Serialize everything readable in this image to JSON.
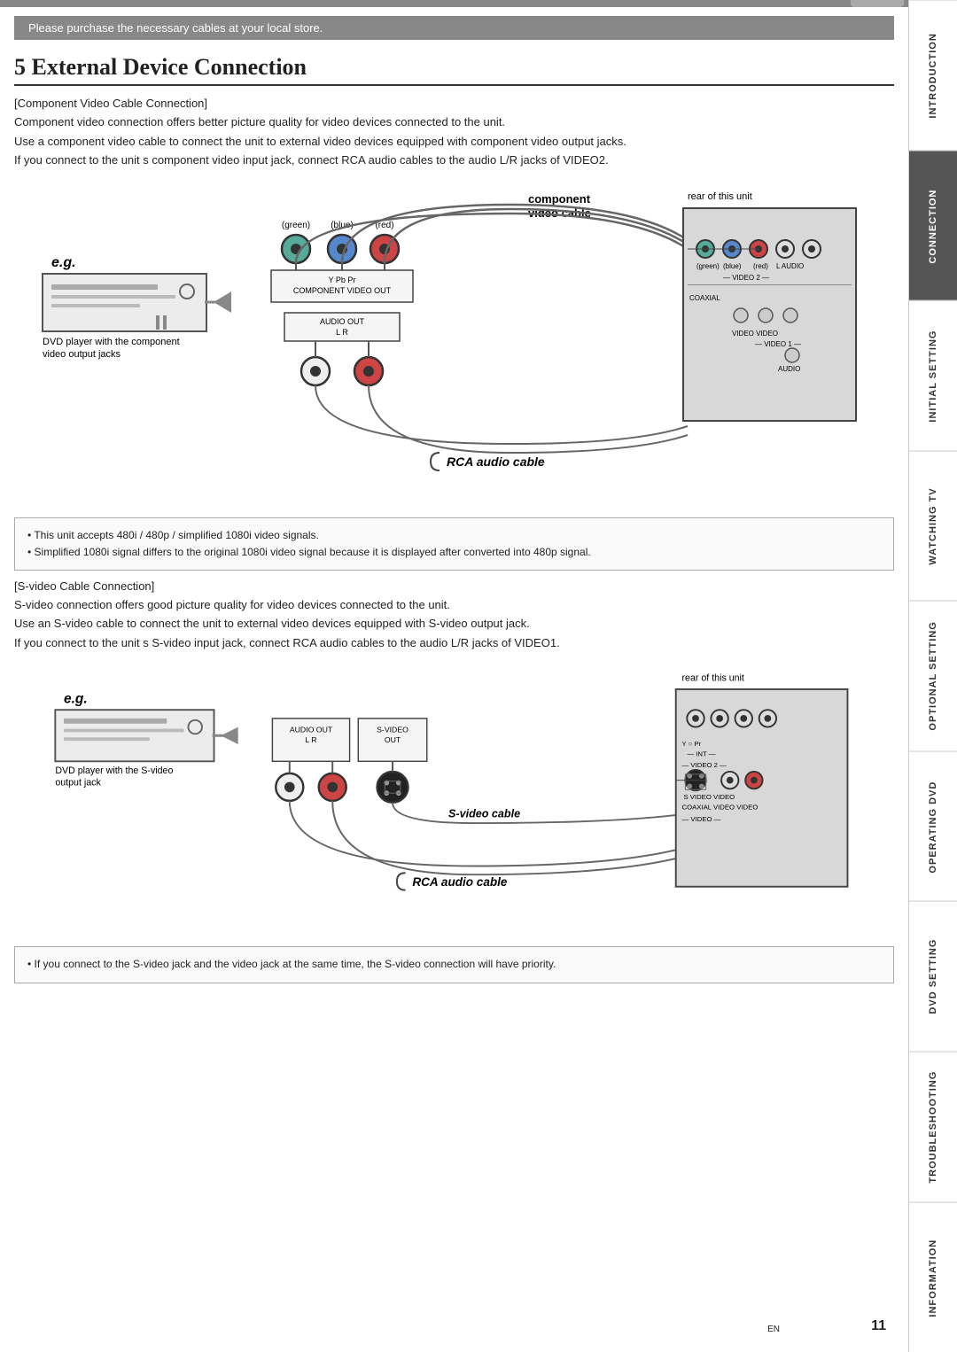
{
  "page": {
    "number": "11",
    "lang": "EN"
  },
  "notice": {
    "text": "Please purchase the necessary cables at your local store."
  },
  "chapter": {
    "number": "5",
    "title": "External Device Connection"
  },
  "component_section": {
    "heading": "[Component Video Cable Connection]",
    "para1": "Component video connection offers better picture quality for video devices connected to the unit.",
    "para2": "Use a component video cable to connect the unit to external video devices equipped with component video output jacks.",
    "para3": "If you connect to the unit s component video input jack, connect RCA audio cables to the audio L/R jacks of VIDEO2.",
    "diagram": {
      "component_cable_label": "component\nvideo cable",
      "eg_label": "e.g.",
      "dvd_label": "DVD player with the component\nvideo output jacks",
      "rear_label": "rear of this unit",
      "connector_labels": [
        "(green)",
        "(blue)",
        "(red)"
      ],
      "component_out_text": "Y    Pb    Pr\nCOMPONENT VIDEO OUT",
      "audio_out_text": "AUDIO OUT\nL         R",
      "rca_label": "RCA audio cable"
    }
  },
  "info_box_1": {
    "line1": "• This unit accepts 480i / 480p / simplified 1080i video signals.",
    "line2": "• Simplified 1080i signal differs to the original 1080i video signal because it is displayed after converted into 480p signal."
  },
  "svideo_section": {
    "heading": "[S-video Cable Connection]",
    "para1": "S-video connection offers good picture quality for video devices connected to the unit.",
    "para2": "Use an S-video cable to connect the unit to external video devices equipped with S-video output jack.",
    "para3": "If you connect to the unit s S-video input jack, connect RCA audio cables to the audio L/R jacks of VIDEO1.",
    "diagram": {
      "eg_label": "e.g.",
      "dvd_label": "DVD player with the S-video\noutput jack",
      "rear_label": "rear of this unit",
      "audio_out_text": "AUDIO OUT\nL    R",
      "svideo_out_text": "S-VIDEO\nOUT",
      "svideo_cable_label": "S-video cable",
      "rca_label": "RCA audio cable"
    }
  },
  "info_box_2": {
    "line1": "• If you connect to the S-video jack and the video jack at the same time, the S-video connection will have priority."
  },
  "sidebar": {
    "tabs": [
      {
        "label": "INTRODUCTION",
        "active": false
      },
      {
        "label": "CONNECTION",
        "active": true
      },
      {
        "label": "INITIAL SETTING",
        "active": false
      },
      {
        "label": "WATCHING TV",
        "active": false
      },
      {
        "label": "OPTIONAL SETTING",
        "active": false
      },
      {
        "label": "OPERATING DVD",
        "active": false
      },
      {
        "label": "DVD SETTING",
        "active": false
      },
      {
        "label": "TROUBLESHOOTING",
        "active": false
      },
      {
        "label": "INFORMATION",
        "active": false
      }
    ]
  }
}
